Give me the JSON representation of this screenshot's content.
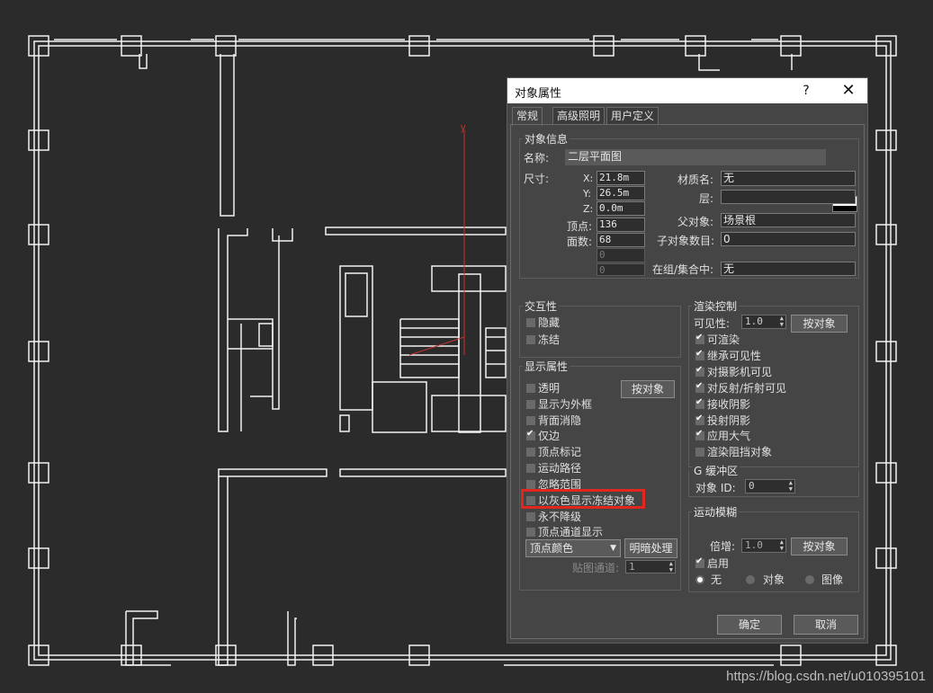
{
  "dialog": {
    "title": "对象属性",
    "help_label": "?",
    "close_label": "✕",
    "tabs": [
      "常规",
      "高级照明",
      "用户定义"
    ],
    "ok_label": "确定",
    "cancel_label": "取消"
  },
  "object_info": {
    "group_label": "对象信息",
    "name_label": "名称:",
    "name_value": "二层平面图",
    "color": "#ffffff",
    "dims_label": "尺寸:",
    "x_label": "X:",
    "x_value": "21.8m",
    "y_label": "Y:",
    "y_value": "26.5m",
    "z_label": "Z:",
    "z_value": "0.0m",
    "verts_label": "顶点:",
    "verts_value": "136",
    "faces_label": "面数:",
    "faces_value": "68",
    "extra1": "0",
    "extra2": "0",
    "material_label": "材质名:",
    "material_value": "无",
    "layer_label": "层:",
    "layer_value": "",
    "parent_label": "父对象:",
    "parent_value": "场景根",
    "children_label": "子对象数目:",
    "children_value": "0",
    "ingroup_label": "在组/集合中:",
    "ingroup_value": "无"
  },
  "interactivity": {
    "group_label": "交互性",
    "hide": "隐藏",
    "freeze": "冻结"
  },
  "display_props": {
    "group_label": "显示属性",
    "by_object": "按对象",
    "items": [
      {
        "label": "透明",
        "checked": false
      },
      {
        "label": "显示为外框",
        "checked": false
      },
      {
        "label": "背面消隐",
        "checked": false
      },
      {
        "label": "仅边",
        "checked": true
      },
      {
        "label": "顶点标记",
        "checked": false
      },
      {
        "label": "运动路径",
        "checked": false
      },
      {
        "label": "忽略范围",
        "checked": false
      },
      {
        "label": "以灰色显示冻结对象",
        "checked": false
      },
      {
        "label": "永不降级",
        "checked": false
      },
      {
        "label": "顶点通道显示",
        "checked": false
      }
    ],
    "vertex_color": "顶点颜色",
    "shaded": "明暗处理",
    "map_channel_label": "贴图通道:",
    "map_channel_value": "1"
  },
  "render_control": {
    "group_label": "渲染控制",
    "visibility_label": "可见性:",
    "visibility_value": "1.0",
    "by_object": "按对象",
    "items": [
      {
        "label": "可渲染",
        "checked": true
      },
      {
        "label": "继承可见性",
        "checked": true
      },
      {
        "label": "对摄影机可见",
        "checked": true
      },
      {
        "label": "对反射/折射可见",
        "checked": true
      },
      {
        "label": "接收阴影",
        "checked": true
      },
      {
        "label": "投射阴影",
        "checked": true
      },
      {
        "label": "应用大气",
        "checked": true
      },
      {
        "label": "渲染阻挡对象",
        "checked": false
      }
    ]
  },
  "gbuffer": {
    "group_label": "G 缓冲区",
    "object_id_label": "对象 ID:",
    "object_id_value": "0"
  },
  "motion_blur": {
    "group_label": "运动模糊",
    "multiplier_label": "倍增:",
    "multiplier_value": "1.0",
    "by_object": "按对象",
    "enable_label": "启用",
    "enable_checked": true,
    "none_label": "无",
    "object_label": "对象",
    "image_label": "图像",
    "selected": "无"
  },
  "viewport": {
    "axis_label": "y"
  },
  "watermark": "https://blog.csdn.net/u010395101"
}
